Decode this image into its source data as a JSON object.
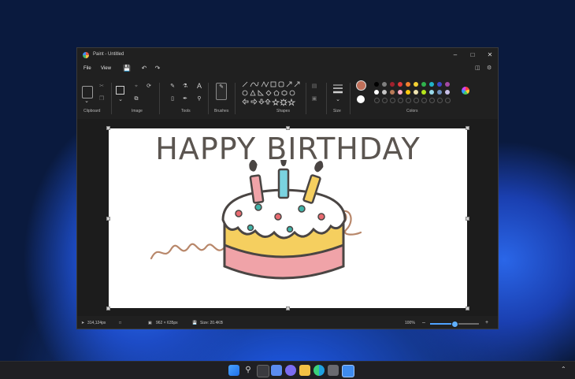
{
  "window": {
    "title": "Paint - Untitled"
  },
  "menu": {
    "file": "File",
    "view": "View"
  },
  "groups": {
    "clipboard": "Clipboard",
    "image": "Image",
    "tools": "Tools",
    "brushes": "Brushes",
    "shapes": "Shapes",
    "size": "Size",
    "colors": "Colors"
  },
  "canvas": {
    "headline": "HAPPY BIRTHDAY"
  },
  "status": {
    "cursor": "314,124px",
    "dimensions": "962 × 635px",
    "size": "Size: 20.4KB",
    "zoom": "100%",
    "zoom_level": 0.5
  },
  "palette": {
    "current": "#c0705a",
    "secondary": "#ffffff",
    "row1": [
      "#000000",
      "#7f7f7f",
      "#a0212d",
      "#e03b3b",
      "#f07f2f",
      "#f5d233",
      "#2fb24c",
      "#21b4c8",
      "#3f48cc",
      "#a349a4"
    ],
    "row2": [
      "#ffffff",
      "#c3c3c3",
      "#b97a57",
      "#ffaec9",
      "#ffc90e",
      "#efe4b0",
      "#b5e61d",
      "#99d9ea",
      "#7092be",
      "#c8bfe7"
    ]
  },
  "icons": {
    "app": "paint-app-icon",
    "save": "save-icon",
    "undo": "undo-icon",
    "redo": "redo-icon"
  }
}
